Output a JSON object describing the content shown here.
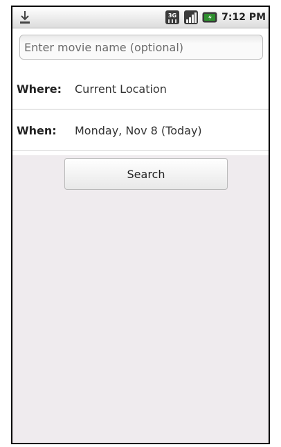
{
  "statusbar": {
    "time": "7:12 PM",
    "network_label": "3G",
    "icons": [
      "download-icon",
      "3g-icon",
      "signal-icon",
      "battery-icon"
    ]
  },
  "form": {
    "movie_placeholder": "Enter movie name (optional)",
    "where_label": "Where:",
    "where_value": "Current Location",
    "when_label": "When:",
    "when_value": "Monday, Nov 8 (Today)",
    "search_button": "Search"
  },
  "colors": {
    "background": "#efebee",
    "battery_green": "#2f8f2f"
  }
}
